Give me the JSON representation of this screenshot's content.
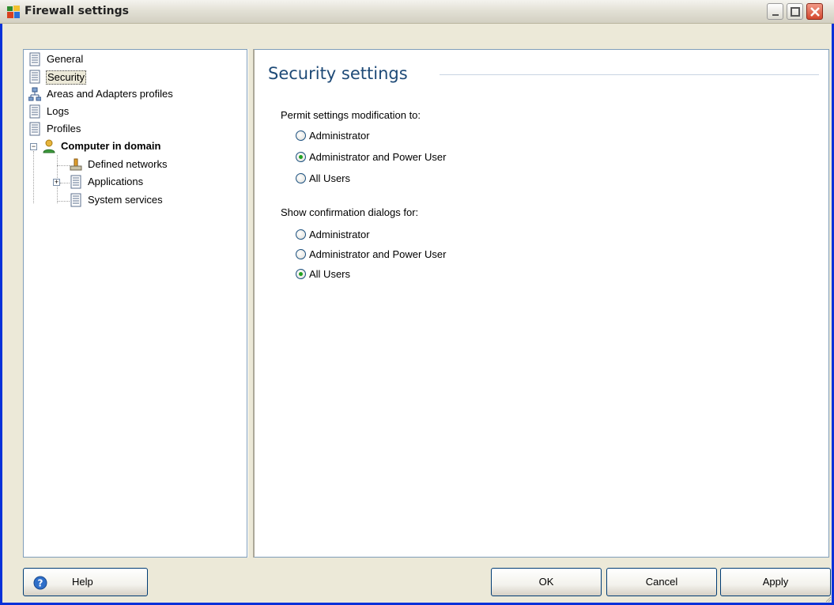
{
  "window": {
    "title": "Firewall settings",
    "controls": {
      "minimize": "minimize",
      "maximize": "maximize",
      "close": "close"
    }
  },
  "tree": {
    "items": [
      {
        "label": "General",
        "icon": "document-icon"
      },
      {
        "label": "Security",
        "icon": "document-icon",
        "selected": true
      },
      {
        "label": "Areas and Adapters profiles",
        "icon": "network-icon"
      },
      {
        "label": "Logs",
        "icon": "document-icon"
      },
      {
        "label": "Profiles",
        "icon": "document-icon"
      },
      {
        "label": "Computer in domain",
        "icon": "user-icon",
        "expanded": true
      },
      {
        "label": "Defined networks",
        "icon": "network-icon"
      },
      {
        "label": "Applications",
        "icon": "document-icon",
        "expandable": true
      },
      {
        "label": "System services",
        "icon": "document-icon"
      }
    ]
  },
  "content": {
    "title": "Security settings",
    "permit_label": "Permit settings modification to:",
    "permit_options": [
      "Administrator",
      "Administrator and Power User",
      "All Users"
    ],
    "permit_selected": "Administrator and Power User",
    "confirm_label": "Show confirmation dialogs for:",
    "confirm_options": [
      "Administrator",
      "Administrator and Power User",
      "All Users"
    ],
    "confirm_selected": "All Users"
  },
  "buttons": {
    "help": "Help",
    "ok": "OK",
    "cancel": "Cancel",
    "apply": "Apply"
  },
  "colors": {
    "accent_title": "#1e4a77",
    "radio_selected": "#21a121"
  }
}
